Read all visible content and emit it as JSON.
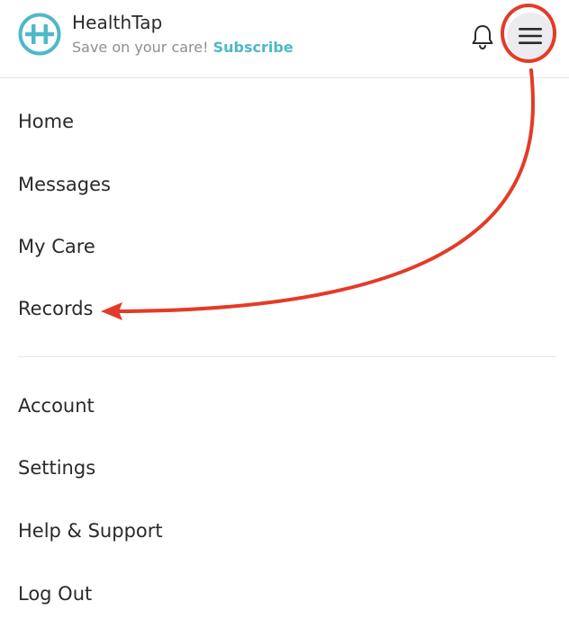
{
  "header": {
    "brand_name": "HealthTap",
    "tagline_prefix": "Save on your care!",
    "subscribe_label": "Subscribe",
    "brand_color": "#4fb8c8"
  },
  "icons": {
    "logo": "healthtap-logo-icon",
    "notifications": "bell-icon",
    "menu": "hamburger-menu-icon"
  },
  "menu": {
    "primary": [
      {
        "label": "Home"
      },
      {
        "label": "Messages"
      },
      {
        "label": "My Care"
      },
      {
        "label": "Records"
      }
    ],
    "secondary": [
      {
        "label": "Account"
      },
      {
        "label": "Settings"
      },
      {
        "label": "Help & Support"
      },
      {
        "label": "Log Out"
      }
    ]
  },
  "annotation": {
    "color": "#e33b29"
  }
}
